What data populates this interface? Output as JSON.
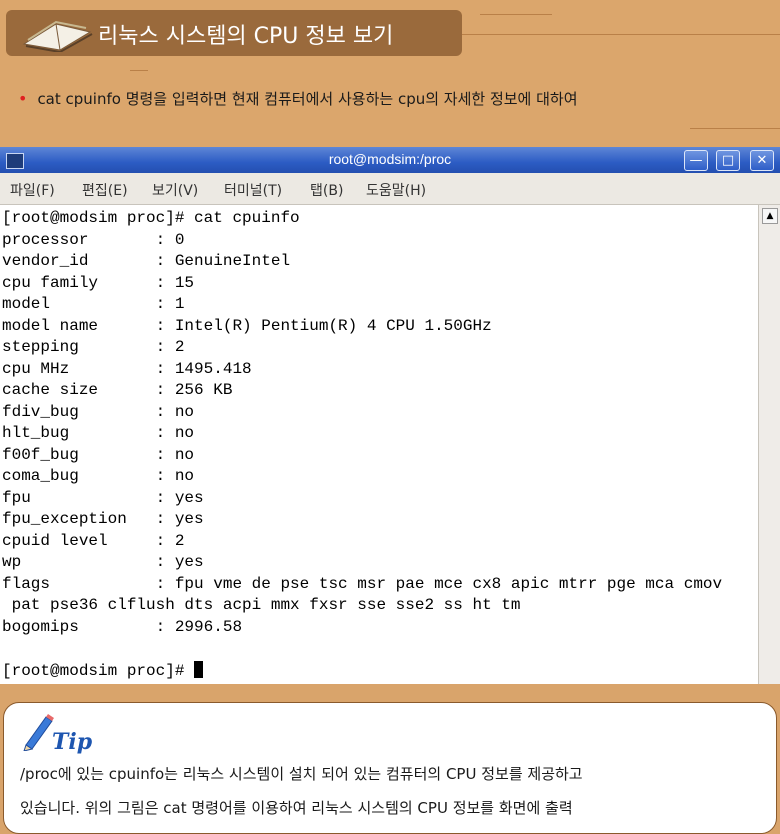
{
  "page": {
    "title": "리눅스 시스템의 CPU 정보 보기",
    "bullet": "cat cpuinfo 명령을 입력하면 현재 컴퓨터에서 사용하는 cpu의 자세한 정보에 대하여"
  },
  "window": {
    "title": "root@modsim:/proc",
    "buttons": {
      "minimize": "—",
      "maximize": "□",
      "close": "✕"
    },
    "menu": [
      "파일(F)",
      "편집(E)",
      "보기(V)",
      "터미널(T)",
      "탭(B)",
      "도움말(H)"
    ]
  },
  "terminal": {
    "lines": [
      "[root@modsim proc]# cat cpuinfo",
      "processor       : 0",
      "vendor_id       : GenuineIntel",
      "cpu family      : 15",
      "model           : 1",
      "model name      : Intel(R) Pentium(R) 4 CPU 1.50GHz",
      "stepping        : 2",
      "cpu MHz         : 1495.418",
      "cache size      : 256 KB",
      "fdiv_bug        : no",
      "hlt_bug         : no",
      "f00f_bug        : no",
      "coma_bug        : no",
      "fpu             : yes",
      "fpu_exception   : yes",
      "cpuid level     : 2",
      "wp              : yes",
      "flags           : fpu vme de pse tsc msr pae mce cx8 apic mtrr pge mca cmov",
      " pat pse36 clflush dts acpi mmx fxsr sse sse2 ss ht tm",
      "bogomips        : 2996.58",
      "",
      "[root@modsim proc]# "
    ]
  },
  "tip": {
    "label": "Tip",
    "line1": "/proc에 있는 cpuinfo는 리눅스 시스템이 설치 되어 있는 컴퓨터의 CPU 정보를 제공하고",
    "line2": "있습니다. 위의 그림은 cat 명령어를 이용하여 리눅스 시스템의 CPU 정보를 화면에 출력"
  },
  "colors": {
    "background": "#d9a46b",
    "title_box": "#9a6a3c",
    "titlebar": "#2c5cc4",
    "bullet": "#e02020",
    "tip_label": "#1e56b0"
  }
}
